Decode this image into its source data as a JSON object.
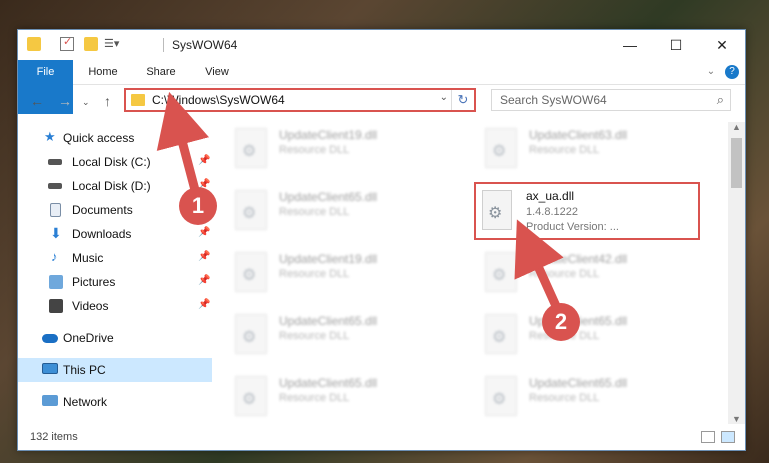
{
  "window": {
    "title": "SysWOW64"
  },
  "ribbon": {
    "tabs": [
      "File",
      "Home",
      "Share",
      "View"
    ]
  },
  "address": {
    "path": "C:\\Windows\\SysWOW64",
    "search_placeholder": "Search SysWOW64"
  },
  "nav": {
    "items": [
      {
        "label": "Quick access",
        "icon": "star-icon"
      },
      {
        "label": "Local Disk (C:)",
        "icon": "drive-icon"
      },
      {
        "label": "Local Disk (D:)",
        "icon": "drive-icon"
      },
      {
        "label": "Documents",
        "icon": "documents-icon"
      },
      {
        "label": "Downloads",
        "icon": "download-icon"
      },
      {
        "label": "Music",
        "icon": "music-icon"
      },
      {
        "label": "Pictures",
        "icon": "pictures-icon"
      },
      {
        "label": "Videos",
        "icon": "videos-icon"
      },
      {
        "label": "OneDrive",
        "icon": "cloud-icon"
      },
      {
        "label": "This PC",
        "icon": "computer-icon"
      },
      {
        "label": "Network",
        "icon": "network-icon"
      }
    ]
  },
  "files": {
    "left": [
      {
        "name": "UpdateClient19.dll",
        "sub": "Resource DLL"
      },
      {
        "name": "UpdateClient65.dll",
        "sub": "Resource DLL"
      },
      {
        "name": "UpdateClient19.dll",
        "sub": "Resource DLL"
      },
      {
        "name": "UpdateClient65.dll",
        "sub": "Resource DLL"
      },
      {
        "name": "UpdateClient65.dll",
        "sub": "Resource DLL"
      },
      {
        "name": "UpdateClient65.dll",
        "sub": "Resource DLL"
      }
    ],
    "right": [
      {
        "name": "UpdateClient63.dll",
        "sub": "Resource DLL"
      },
      {
        "name": "UpdateClient42.dll",
        "sub": "Resource DLL"
      },
      {
        "name": "UpdateClient65.dll",
        "sub": "Resource DLL"
      },
      {
        "name": "UpdateClient65.dll",
        "sub": "Resource DLL"
      }
    ],
    "highlighted": {
      "name": "ax_ua.dll",
      "version": "1.4.8.1222",
      "product": "Product Version:     ..."
    }
  },
  "status": {
    "count": "132 items"
  },
  "annotations": {
    "badge1": "1",
    "badge2": "2",
    "color": "#d9534f"
  }
}
